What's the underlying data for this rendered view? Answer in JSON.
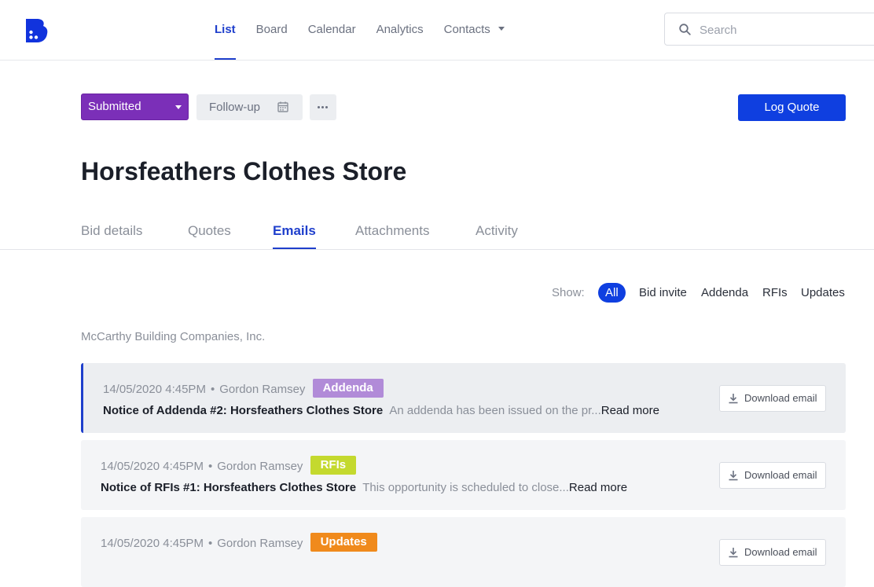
{
  "nav": {
    "items": [
      {
        "label": "List",
        "active": true
      },
      {
        "label": "Board"
      },
      {
        "label": "Calendar"
      },
      {
        "label": "Analytics"
      },
      {
        "label": "Contacts",
        "dropdown": true
      }
    ],
    "search_placeholder": "Search"
  },
  "toolbar": {
    "status_label": "Submitted",
    "followup_label": "Follow-up",
    "log_quote_label": "Log Quote"
  },
  "page_title": "Horsfeathers Clothes Store",
  "tabs": [
    {
      "label": "Bid details"
    },
    {
      "label": "Quotes"
    },
    {
      "label": "Emails",
      "active": true
    },
    {
      "label": "Attachments"
    },
    {
      "label": "Activity"
    }
  ],
  "filters": {
    "show_label": "Show:",
    "options": [
      "All",
      "Bid invite",
      "Addenda",
      "RFIs",
      "Updates"
    ],
    "active": "All"
  },
  "company": "McCarthy Building Companies, Inc.",
  "emails": [
    {
      "date": "14/05/2020 4:45PM",
      "sender": "Gordon Ramsey",
      "badge": "Addenda",
      "badge_color": "#b18bd8",
      "subject": "Notice of Addenda #2: Horsfeathers Clothes Store",
      "snippet": "An addenda has been issued on the pr...",
      "read_more": "Read more",
      "download_label": "Download email"
    },
    {
      "date": "14/05/2020 4:45PM",
      "sender": "Gordon Ramsey",
      "badge": "RFIs",
      "badge_color": "#c4d92e",
      "subject": "Notice of RFIs #1: Horsfeathers Clothes Store",
      "snippet": "This opportunity is scheduled to close...",
      "read_more": "Read more",
      "download_label": "Download email"
    },
    {
      "date": "14/05/2020 4:45PM",
      "sender": "Gordon Ramsey",
      "badge": "Updates",
      "badge_color": "#f08a1c",
      "subject": "",
      "snippet": "",
      "read_more": "",
      "download_label": "Download email"
    }
  ],
  "colors": {
    "accent": "#1f3fcc",
    "primary_button": "#0f3fe0",
    "status_purple": "#7b2fb8"
  }
}
